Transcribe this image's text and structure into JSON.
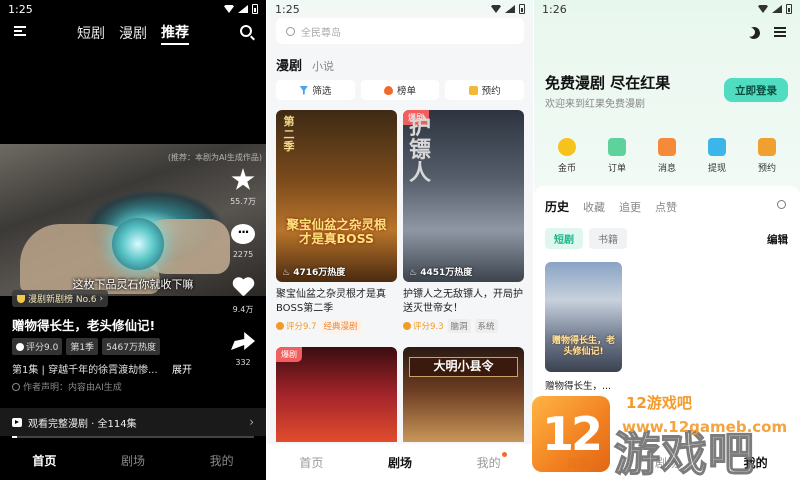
{
  "panel1": {
    "status_time": "1:25",
    "nav_tabs": [
      "短剧",
      "漫剧",
      "推荐"
    ],
    "video_watermark": "(推荐：本剧为AI生成作品)",
    "subtitle": "这枚下品灵石你就收下嘛",
    "actions": [
      {
        "icon": "star-icon",
        "count": "55.7万"
      },
      {
        "icon": "comment-icon",
        "count": "2275"
      },
      {
        "icon": "heart-icon",
        "count": "9.4万"
      },
      {
        "icon": "share-icon",
        "count": "332"
      }
    ],
    "rank_badge": "漫剧新剧榜 No.6",
    "title": "赠物得长生，老头修仙记!",
    "chips": [
      "评分9.0",
      "第1季",
      "5467万热度"
    ],
    "episode_line": "第1集 | 穿越千年的徐霄渡劫惨...",
    "expand": "展开",
    "notice": "作者声明：内容由AI生成",
    "watch_full": "观看完整漫剧 · 全114集",
    "progress": 0.02,
    "bottom_nav": [
      "首页",
      "剧场",
      "我的"
    ]
  },
  "panel2": {
    "status_time": "1:25",
    "search_placeholder": "全民尊岛",
    "seg_tabs": [
      "漫剧",
      "小说"
    ],
    "filters": [
      "筛选",
      "榜单",
      "预约"
    ],
    "cards": [
      {
        "tag": "",
        "poster_text": "聚宝仙盆之杂灵根才是真BOSS",
        "season": "第二季",
        "heat": "4716万热度",
        "title": "聚宝仙盆之杂灵根才是真BOSS第二季",
        "score": "评分9.7",
        "genres": [
          "经典漫剧"
        ]
      },
      {
        "tag": "爆剧",
        "poster_text": "护镖人",
        "season": "",
        "heat": "4451万热度",
        "title": "护镖人之无敌镖人，开局护送灭世帝女！",
        "score": "评分9.3",
        "genres": [
          "脑洞",
          "系统"
        ]
      }
    ],
    "cards_row2": [
      {
        "tag": "爆剧",
        "poster_text": ""
      },
      {
        "tag": "",
        "poster_text": "大明小县令"
      }
    ],
    "bottom_nav": [
      "首页",
      "剧场",
      "我的"
    ]
  },
  "panel3": {
    "status_time": "1:26",
    "promo_title": "免费漫剧 尽在红果",
    "promo_sub": "欢迎来到红果免费漫剧",
    "login_button": "立即登录",
    "quick_actions": [
      {
        "icon": "coin-icon",
        "label": "金币"
      },
      {
        "icon": "order-icon",
        "label": "订单"
      },
      {
        "icon": "message-icon",
        "label": "消息"
      },
      {
        "icon": "withdraw-icon",
        "label": "提现"
      },
      {
        "icon": "reserve-icon",
        "label": "预约"
      }
    ],
    "history_tabs": [
      "历史",
      "收藏",
      "追更",
      "点赞"
    ],
    "sub_tabs": [
      "短剧",
      "书籍"
    ],
    "edit": "编辑",
    "history_item": {
      "poster_text": "赠物得长生，老头修仙记!",
      "title": "赠物得长生，..."
    },
    "bottom_nav": [
      "首页",
      "剧场",
      "我的"
    ]
  },
  "site_watermark": {
    "logo_text": "12",
    "name_cn": "游戏吧",
    "top_text": "12游戏吧",
    "url": "www.12gameb.com"
  }
}
